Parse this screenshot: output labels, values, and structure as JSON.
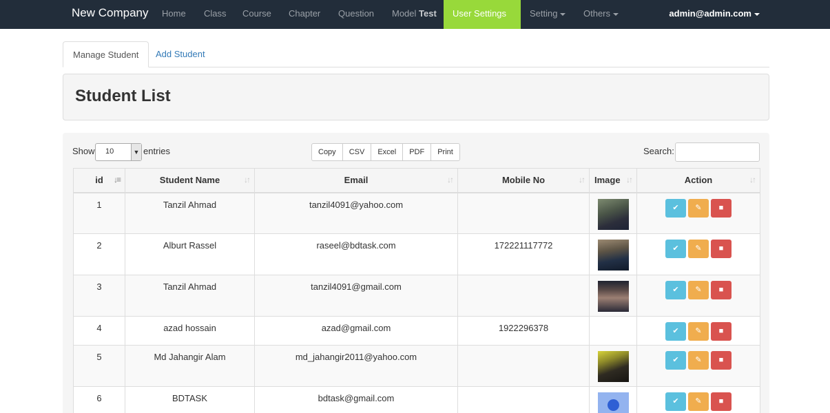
{
  "navbar": {
    "brand": "New Company",
    "items": [
      {
        "label": "Home"
      },
      {
        "label": "Class"
      },
      {
        "label": "Course"
      },
      {
        "label": "Chapter"
      },
      {
        "label": "Question"
      },
      {
        "label": "Model",
        "bold": "Test"
      },
      {
        "label": "User Settings"
      },
      {
        "label": "Setting"
      },
      {
        "label": "Others"
      }
    ],
    "user": "admin@admin.com",
    "active_color": "#98d93a",
    "bg_color": "#222d3a"
  },
  "tabs": {
    "manage": "Manage Student",
    "add": "Add Student"
  },
  "panel": {
    "title": "Student List"
  },
  "controls": {
    "show": "Show",
    "entries_value": "10",
    "entries": "entries",
    "search": "Search:",
    "export": [
      "Copy",
      "CSV",
      "Excel",
      "PDF",
      "Print"
    ]
  },
  "table": {
    "headers": [
      "id",
      "Student Name",
      "Email",
      "Mobile No",
      "Image",
      "Action"
    ],
    "rows": [
      {
        "id": "1",
        "name": "Tanzil Ahmad",
        "email": "tanzil4091@yahoo.com",
        "mobile": "",
        "image": "avatar-1"
      },
      {
        "id": "2",
        "name": "Alburt Rassel",
        "email": "raseel@bdtask.com",
        "mobile": "172221117772",
        "image": "avatar-2"
      },
      {
        "id": "3",
        "name": "Tanzil Ahmad",
        "email": "tanzil4091@gmail.com",
        "mobile": "",
        "image": "avatar-3"
      },
      {
        "id": "4",
        "name": "azad hossain",
        "email": "azad@gmail.com",
        "mobile": "1922296378",
        "image": ""
      },
      {
        "id": "5",
        "name": "Md Jahangir Alam",
        "email": "md_jahangir2011@yahoo.com",
        "mobile": "",
        "image": "avatar-5"
      },
      {
        "id": "6",
        "name": "BDTASK",
        "email": "bdtask@gmail.com",
        "mobile": "",
        "image": "avatar-6"
      }
    ],
    "action_icons": [
      "check-icon",
      "edit-icon",
      "trash-icon"
    ],
    "action_colors": [
      "#5bc0de",
      "#f0ad4e",
      "#d9534f"
    ]
  }
}
